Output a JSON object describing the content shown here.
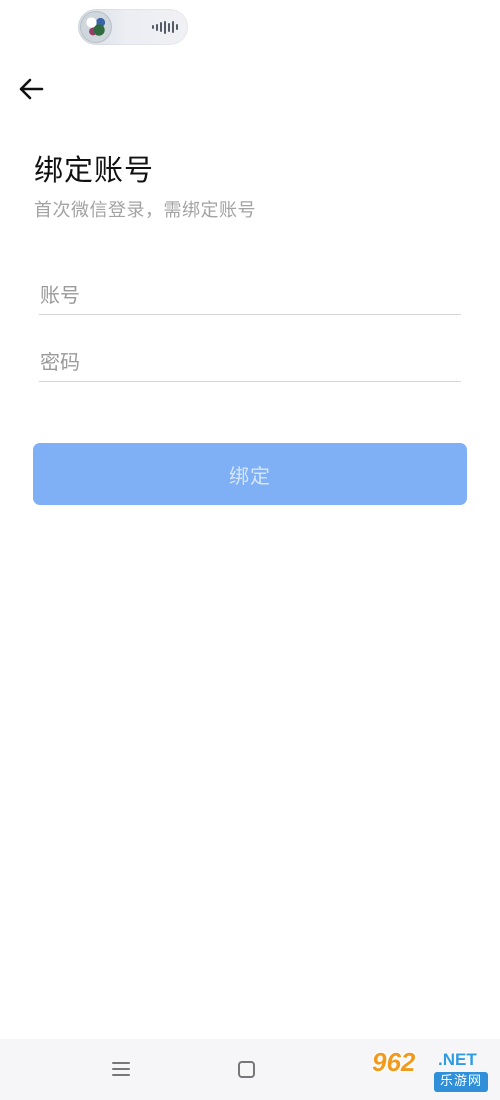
{
  "header": {
    "title": "绑定账号",
    "subtitle": "首次微信登录，需绑定账号"
  },
  "form": {
    "account_placeholder": "账号",
    "account_value": "",
    "password_placeholder": "密码",
    "password_value": "",
    "submit_label": "绑定"
  },
  "colors": {
    "button_bg": "#7fb0f5",
    "button_text": "#d6e6fc",
    "subtitle": "#a3a3a3",
    "watermark_orange": "#f29a1e",
    "watermark_blue": "#2f9be0"
  },
  "icons": {
    "back": "arrow-left-icon",
    "menu": "menu-icon",
    "home": "home-icon",
    "audio": "audio-wave-icon"
  },
  "watermark": {
    "digits": "962",
    "domain": ".NET",
    "site": "乐游网"
  }
}
